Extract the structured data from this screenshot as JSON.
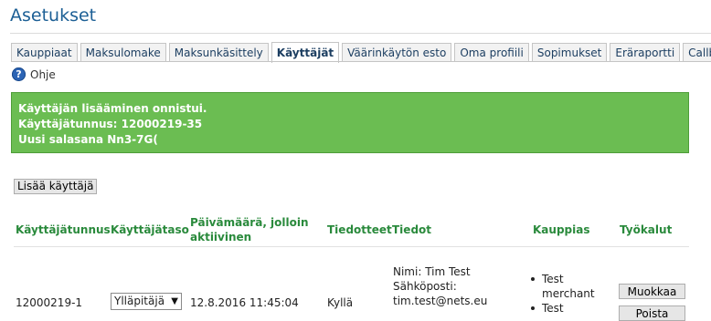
{
  "page": {
    "title": "Asetukset"
  },
  "tabs": [
    {
      "label": "Kauppiaat",
      "active": false
    },
    {
      "label": "Maksulomake",
      "active": false
    },
    {
      "label": "Maksunkäsittely",
      "active": false
    },
    {
      "label": "Käyttäjät",
      "active": true
    },
    {
      "label": "Väärinkäytön esto",
      "active": false
    },
    {
      "label": "Oma profiili",
      "active": false
    },
    {
      "label": "Sopimukset",
      "active": false
    },
    {
      "label": "Eräraportti",
      "active": false
    },
    {
      "label": "Callback",
      "active": false
    }
  ],
  "help": {
    "icon": "help-icon",
    "label": "Ohje"
  },
  "notice": {
    "color": "#6bbd52",
    "line1": "Käyttäjän lisääminen onnistui.",
    "line2": "Käyttäjätunnus: 12000219-35",
    "line3": "Uusi salasana Nn3-7G("
  },
  "add_button": {
    "label": "Lisää käyttäjä"
  },
  "table": {
    "headers": {
      "username": "Käyttäjätunnus",
      "level": "Käyttäjätaso",
      "date_line1": "Päivämäärä, jolloin",
      "date_line2": "aktiivinen",
      "bulletins": "Tiedotteet",
      "info": "Tiedot",
      "merchant": "Kauppias",
      "tools": "Työkalut"
    },
    "rows": [
      {
        "username": "12000219-1",
        "level": "Ylläpitäjä",
        "date": "12.8.2016 11:45:04",
        "bulletins": "Kyllä",
        "info_name": "Nimi: Tim Test",
        "info_email_label": "Sähköposti:",
        "info_email": "tim.test@nets.eu",
        "merchants": [
          {
            "line1": "Test",
            "line2": "merchant"
          },
          {
            "line1": "Test",
            "line2": ""
          }
        ],
        "edit_label": "Muokkaa",
        "delete_label": "Poista"
      }
    ]
  }
}
